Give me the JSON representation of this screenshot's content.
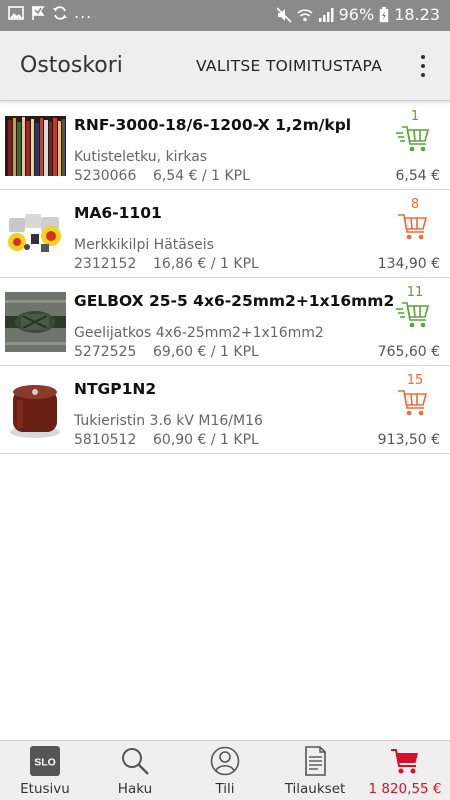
{
  "status_bar": {
    "battery": "96%",
    "time": "18.23",
    "dots": "..."
  },
  "app_bar": {
    "title": "Ostoskori",
    "action": "VALITSE TOIMITUSTAPA"
  },
  "colors": {
    "green": "#5aa632",
    "orange": "#f06a3a",
    "red": "#d8112a"
  },
  "items": [
    {
      "name": "RNF-3000-18/6-1200-X 1,2m/kpl",
      "description": "Kutisteletku, kirkas",
      "code": "5230066",
      "unit_price": "6,54 € / 1 KPL",
      "total": "6,54 €",
      "quantity": "1",
      "status": "green"
    },
    {
      "name": "MA6-1101",
      "description": "Merkkikilpi Hätäseis",
      "code": "2312152",
      "unit_price": "16,86 € / 1 KPL",
      "total": "134,90 €",
      "quantity": "8",
      "status": "orange"
    },
    {
      "name": "GELBOX 25-5 4x6-25mm2+1x16mm2",
      "description": "Geelijatkos 4x6-25mm2+1x16mm2",
      "code": "5272525",
      "unit_price": "69,60 € / 1 KPL",
      "total": "765,60 €",
      "quantity": "11",
      "status": "green"
    },
    {
      "name": "NTGP1N2",
      "description": "Tukieristin  3.6 kV M16/M16",
      "code": "5810512",
      "unit_price": "60,90 € / 1 KPL",
      "total": "913,50 €",
      "quantity": "15",
      "status": "orange"
    }
  ],
  "bottom_nav": {
    "home_logo": "SLO",
    "home": "Etusivu",
    "search": "Haku",
    "account": "Tili",
    "orders": "Tilaukset",
    "cart_total": "1 820,55 €"
  }
}
